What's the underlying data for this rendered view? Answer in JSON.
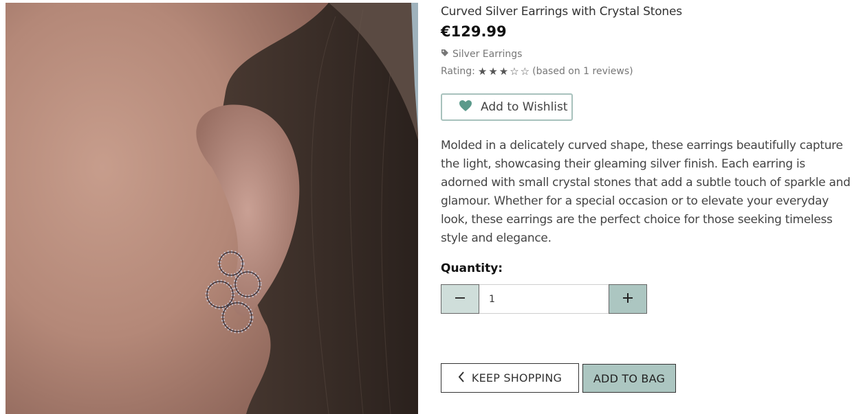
{
  "product": {
    "title": "Curved Silver Earrings with Crystal Stones",
    "price": "€129.99",
    "category": "Silver Earrings",
    "rating_label": "Rating:",
    "rating_value": 3,
    "rating_max": 5,
    "reviews_text": "(based on 1 reviews)",
    "description": "Molded in a delicately curved shape, these earrings beautifully capture the light, showcasing their gleaming silver finish. Each earring is adorned with small crystal stones that add a subtle touch of sparkle and glamour. Whether for a special occasion or to elevate your everyday look, these earrings are the perfect choice for those seeking timeless style and elegance."
  },
  "wishlist": {
    "label": "Add to Wishlist",
    "icon": "heart-icon",
    "icon_color": "#5b9a8b"
  },
  "quantity": {
    "label": "Quantity:",
    "value": "1"
  },
  "actions": {
    "keep_shopping": "KEEP SHOPPING",
    "add_to_bag": "ADD TO BAG"
  },
  "colors": {
    "accent": "#acc6c1",
    "accent_light": "#cfdeda"
  }
}
